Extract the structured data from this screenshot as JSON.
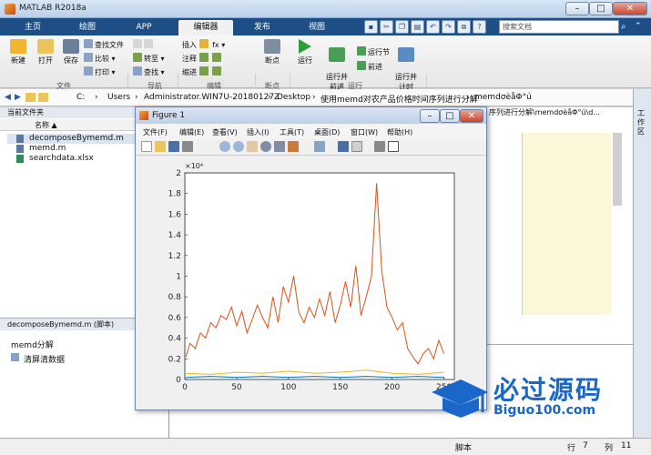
{
  "window": {
    "title": "MATLAB R2018a",
    "min": "–",
    "max": "□",
    "close": "✕"
  },
  "tabs": [
    "主页",
    "绘图",
    "APP",
    "编辑器",
    "发布",
    "视图"
  ],
  "active_tab": "编辑器",
  "search_placeholder": "搜索文档",
  "ribbon": {
    "file": {
      "new": "新建",
      "open": "打开",
      "save": "保存",
      "find_files": "查找文件",
      "compare": "比较",
      "print": "打印",
      "group": "文件"
    },
    "nav": {
      "goto": "转至",
      "find": "查找",
      "group": "导航"
    },
    "edit": {
      "insert": "插入",
      "comment": "注释",
      "indent": "缩进",
      "fx": "fx",
      "group": "编辑"
    },
    "breakpoints": {
      "label": "断点",
      "group": "断点"
    },
    "run": {
      "run": "运行",
      "run_advance": "运行并\n前进",
      "run_section": "运行节",
      "advance": "前进",
      "run_time": "运行并\n计时",
      "group": "运行"
    }
  },
  "address": {
    "path": [
      "C:",
      "Users",
      "Administrator.WIN7U-20180127Z",
      "Desktop",
      "使用memd对农产品价格时间序列进行分解",
      "memdσèåΦ°ú"
    ]
  },
  "left": {
    "title": "当前文件夹",
    "col": "名称 ▲",
    "files": [
      "decomposeBymemd.m",
      "memd.m",
      "searchdata.xlsx"
    ],
    "detail_title": "decomposeBymemd.m  (脚本)",
    "detail_items": [
      "memd分解",
      "清屏清数据"
    ]
  },
  "right": {
    "path_text": "序列进行分解\\memdσèåΦ°ú\\d..."
  },
  "workspace_label": "工作区",
  "status": {
    "mode": "脚本",
    "row_label": "行",
    "row": "7",
    "col_label": "列",
    "col": "11"
  },
  "figure": {
    "title": "Figure 1",
    "menu": [
      "文件(F)",
      "编辑(E)",
      "查看(V)",
      "插入(I)",
      "工具(T)",
      "桌面(D)",
      "窗口(W)",
      "帮助(H)"
    ]
  },
  "brand": {
    "name": "必过源码",
    "url": "Biguo100.com"
  },
  "chart_data": {
    "type": "line",
    "exponent_label": "×10⁴",
    "xlim": [
      0,
      260
    ],
    "ylim": [
      0,
      2
    ],
    "xticks": [
      0,
      50,
      100,
      150,
      200,
      250
    ],
    "yticks": [
      0,
      0.2,
      0.4,
      0.6,
      0.8,
      1,
      1.2,
      1.4,
      1.6,
      1.8,
      2
    ],
    "series": [
      {
        "color": "#d95319",
        "x": [
          1,
          5,
          10,
          15,
          20,
          25,
          30,
          35,
          40,
          45,
          50,
          55,
          60,
          65,
          70,
          75,
          80,
          85,
          90,
          95,
          100,
          105,
          110,
          115,
          120,
          125,
          130,
          135,
          140,
          145,
          150,
          155,
          160,
          165,
          170,
          175,
          180,
          185,
          190,
          195,
          200,
          205,
          210,
          215,
          220,
          225,
          230,
          235,
          240,
          245,
          250
        ],
        "values": [
          0.22,
          0.35,
          0.3,
          0.45,
          0.4,
          0.55,
          0.5,
          0.62,
          0.58,
          0.7,
          0.52,
          0.66,
          0.45,
          0.58,
          0.72,
          0.6,
          0.5,
          0.8,
          0.55,
          0.9,
          0.75,
          1.0,
          0.65,
          0.55,
          0.7,
          0.6,
          0.78,
          0.62,
          0.85,
          0.55,
          0.72,
          0.95,
          0.7,
          1.1,
          0.62,
          0.8,
          1.0,
          1.9,
          1.05,
          0.7,
          0.6,
          0.48,
          0.55,
          0.3,
          0.22,
          0.15,
          0.25,
          0.3,
          0.2,
          0.38,
          0.25
        ]
      },
      {
        "color": "#edb120",
        "x": [
          1,
          25,
          50,
          75,
          100,
          125,
          150,
          175,
          200,
          225,
          250
        ],
        "values": [
          0.06,
          0.05,
          0.07,
          0.06,
          0.08,
          0.06,
          0.07,
          0.09,
          0.06,
          0.05,
          0.07
        ]
      },
      {
        "color": "#0072bd",
        "x": [
          1,
          25,
          50,
          75,
          100,
          125,
          150,
          175,
          200,
          225,
          250
        ],
        "values": [
          0.02,
          0.03,
          0.02,
          0.03,
          0.02,
          0.03,
          0.02,
          0.03,
          0.02,
          0.03,
          0.02
        ]
      }
    ]
  }
}
